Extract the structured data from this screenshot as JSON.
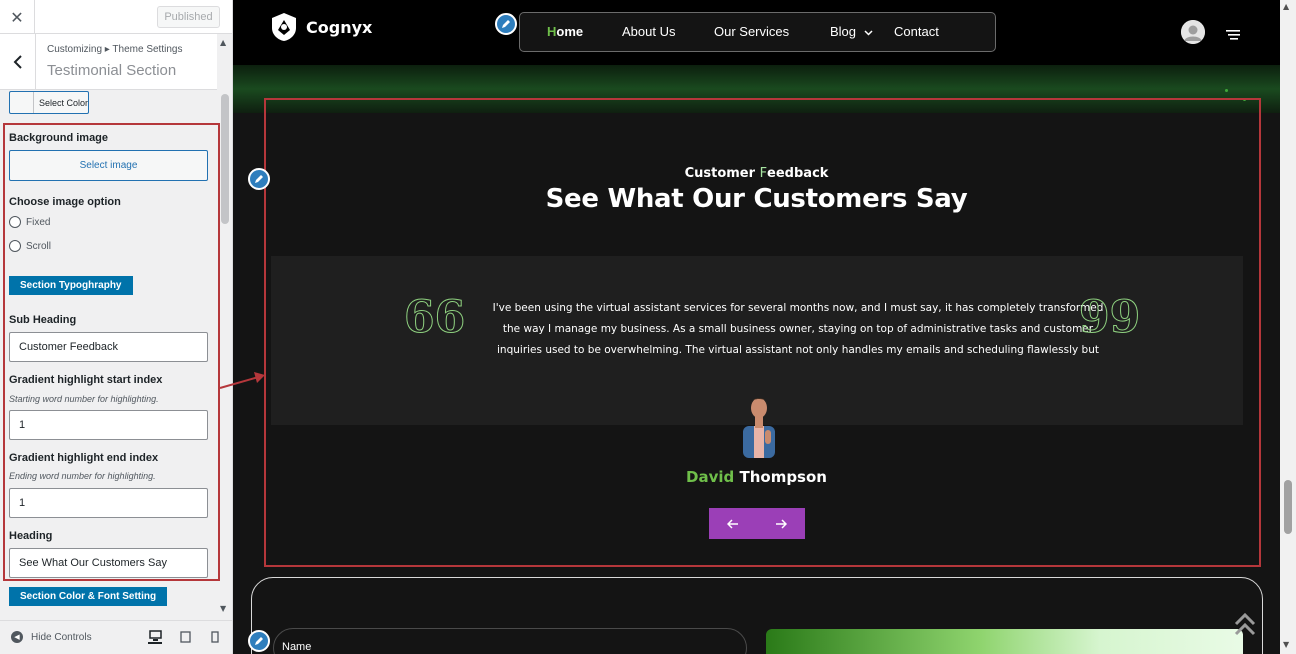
{
  "sidebar": {
    "close_icon": "close-icon",
    "publish_label": "Published",
    "breadcrumb": "Customizing ▸ Theme Settings",
    "section_title": "Testimonial Section",
    "select_color_label": "Select Color",
    "background_image_label": "Background image",
    "select_image_label": "Select image",
    "image_option_label": "Choose image option",
    "image_options": [
      "Fixed",
      "Scroll"
    ],
    "section_typography_label": "Section Typoghraphy",
    "sub_heading_label": "Sub Heading",
    "sub_heading_value": "Customer Feedback",
    "gradient_start_label": "Gradient highlight start index",
    "gradient_start_desc": "Starting word number for highlighting.",
    "gradient_start_value": "1",
    "gradient_end_label": "Gradient highlight end index",
    "gradient_end_desc": "Ending word number for highlighting.",
    "gradient_end_value": "1",
    "heading_label": "Heading",
    "heading_value": "See What Our Customers Say",
    "section_color_label": "Section Color & Font Setting",
    "hide_controls_label": "Hide Controls"
  },
  "site": {
    "logo_text": "Cognyx",
    "nav": {
      "home_first": "H",
      "home_rest": "ome",
      "items": [
        "About Us",
        "Our Services",
        "Blog",
        "Contact"
      ]
    }
  },
  "testimonial": {
    "sub_heading_plain": "Customer ",
    "sub_heading_first": "F",
    "sub_heading_rest": "eedback",
    "heading": "See What Our Customers Say",
    "quote": "I've been using the virtual assistant services for several months now, and I must say, it has completely transformed the way I manage my business. As a small business owner, staying on top of administrative tasks and customer inquiries used to be overwhelming. The virtual assistant not only handles my emails and scheduling flawlessly but",
    "open_quote": "66",
    "close_quote": "99",
    "author_first": "David",
    "author_last": " Thompson"
  },
  "contact": {
    "name_label": "Name"
  },
  "colors": {
    "accent_green": "#6fbf4a",
    "highlight_green": "#a6e3a0",
    "nav_button_purple": "#9b3fb7",
    "annotation_red": "#b5373b",
    "wp_blue": "#0073aa"
  }
}
